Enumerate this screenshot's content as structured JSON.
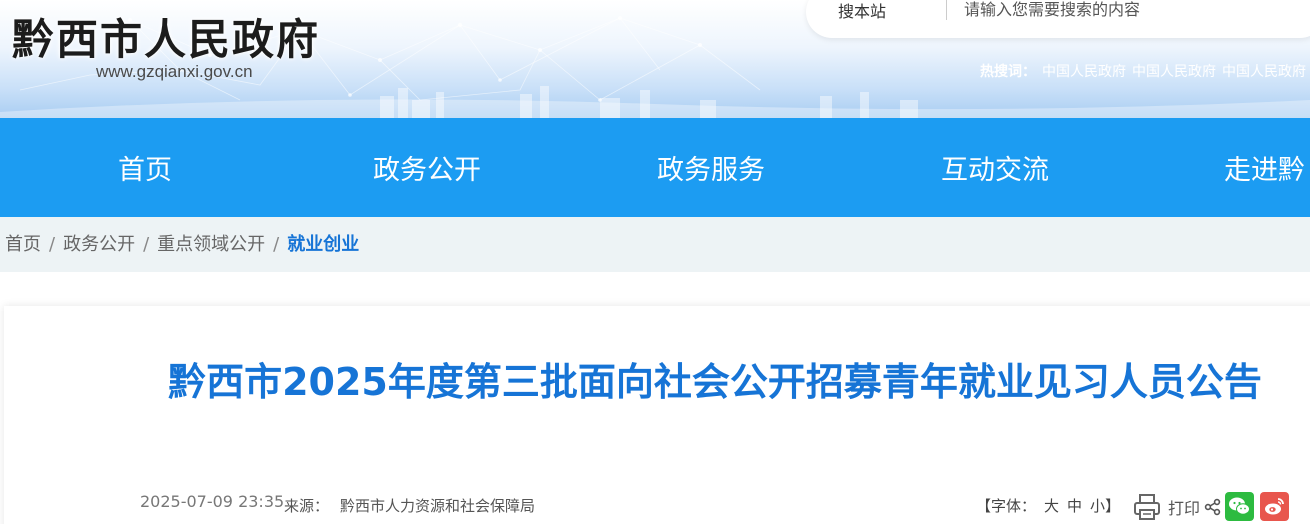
{
  "header": {
    "site_title": "黔西市人民政府",
    "site_url": "www.gzqianxi.gov.cn",
    "search": {
      "scope": "搜本站",
      "placeholder": "请输入您需要搜索的内容"
    },
    "hot_search": {
      "label": "热搜词：",
      "links": [
        "中国人民政府",
        "中国人民政府",
        "中国人民政府"
      ]
    }
  },
  "nav": {
    "items": [
      "首页",
      "政务公开",
      "政务服务",
      "互动交流",
      "走进黔"
    ]
  },
  "breadcrumb": {
    "items": [
      "首页",
      "政务公开",
      "重点领域公开"
    ],
    "separator": "/",
    "current": "就业创业"
  },
  "article": {
    "title": "黔西市2025年度第三批面向社会公开招募青年就业见习人员公告",
    "date": "2025-07-09 23:35",
    "source_label": "来源：",
    "source": "黔西市人力资源和社会保障局",
    "font_label": "【字体：",
    "font_sizes": [
      "大",
      "中",
      "小"
    ],
    "font_close": "】",
    "print_label": "打印"
  },
  "colors": {
    "nav_bg": "#1c9cf2",
    "title": "#1674d6",
    "breadcrumb_bg": "#edf3f5",
    "wechat": "#2dbb40",
    "weibo": "#e8564d"
  },
  "icons": [
    "print-icon",
    "share-icon",
    "wechat-icon",
    "weibo-icon"
  ]
}
